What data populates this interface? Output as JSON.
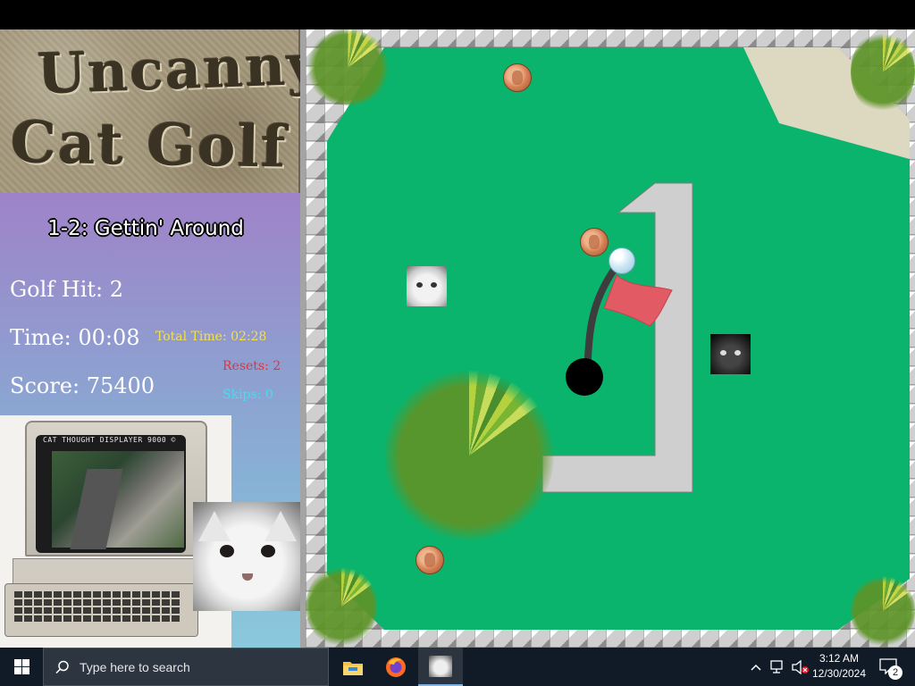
{
  "game": {
    "title_line_1": "Uncanny",
    "title_line_2": "Cat Golf",
    "level_title": "1-2: Gettin' Around",
    "golf_hit": "Golf Hit: 2",
    "time": "Time: 00:08",
    "total_time": "Total Time: 02:28",
    "resets": "Resets: 2",
    "score": "Score: 75400",
    "skips": "Skips: 0",
    "monitor_caption": "CAT THOUGHT DISPLAYER 9000 ©"
  },
  "colors": {
    "fairway": "#0bb46d",
    "sand": "#ddd8c0",
    "flag": "#e25a63",
    "total_time": "#f4e04b",
    "resets": "#e0343c",
    "skips": "#49dcef"
  },
  "taskbar": {
    "search_placeholder": "Type here to search",
    "time": "3:12 AM",
    "date": "12/30/2024",
    "notification_count": "2",
    "pinned": [
      "file-explorer-icon",
      "firefox-icon",
      "cat-golf-app-icon"
    ]
  }
}
